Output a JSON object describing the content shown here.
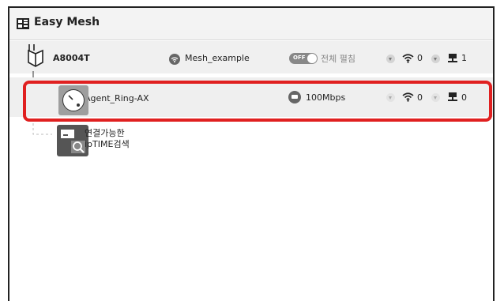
{
  "app": {
    "title": "Easy Mesh"
  },
  "controller": {
    "model": "A8004T",
    "ssid": "Mesh_example",
    "toggle_state": "OFF",
    "toggle_label": "전체 펼침",
    "wifi_count": "0",
    "wired_count": "1"
  },
  "agent": {
    "name": "Agent_Ring-AX",
    "link_speed": "100Mbps",
    "wifi_count": "0",
    "wired_count": "0"
  },
  "search": {
    "line1": "연결가능한",
    "line2": "ipTIME검색"
  },
  "colors": {
    "highlight": "#e02020",
    "toggle_bg": "#888888"
  }
}
